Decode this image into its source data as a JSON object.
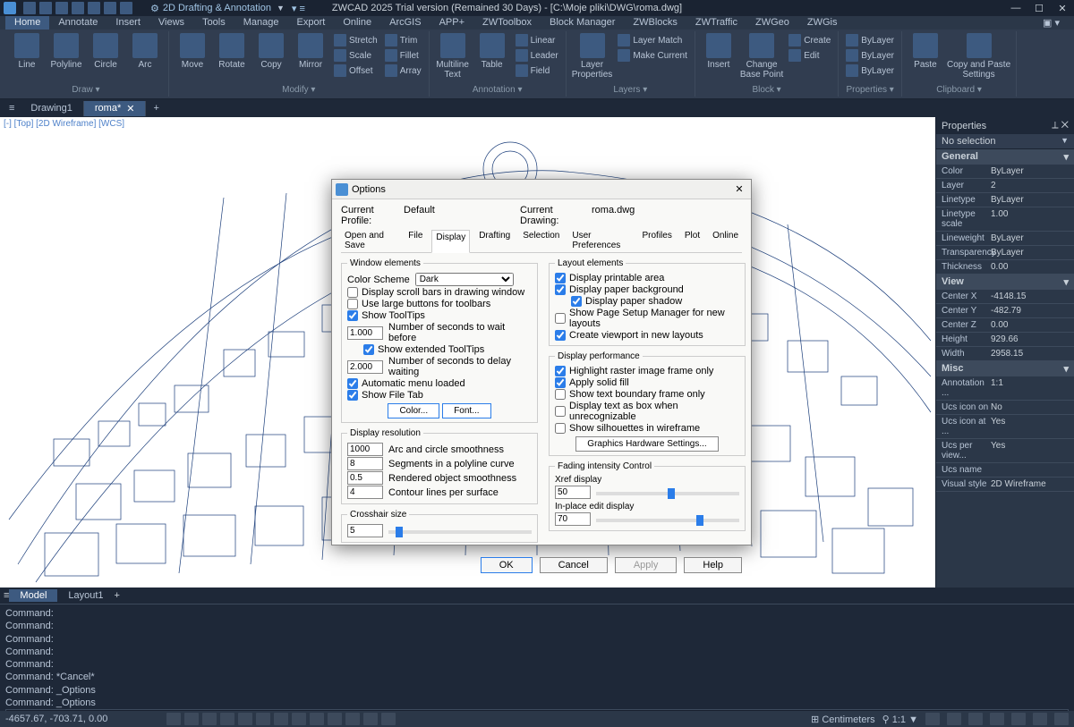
{
  "window": {
    "workspace": "2D Drafting & Annotation",
    "title": "ZWCAD 2025 Trial version (Remained 30 Days) - [C:\\Moje pliki\\DWG\\roma.dwg]"
  },
  "menubar": [
    "Home",
    "Annotate",
    "Insert",
    "Views",
    "Tools",
    "Manage",
    "Export",
    "Online",
    "ArcGIS",
    "APP+",
    "ZWToolbox",
    "Block Manager",
    "ZWBlocks",
    "ZWTraffic",
    "ZWGeo",
    "ZWGis"
  ],
  "menubar_active": "Home",
  "ribbon": {
    "panels": [
      {
        "label": "Draw",
        "big": [
          {
            "t": "Line"
          },
          {
            "t": "Polyline"
          },
          {
            "t": "Circle"
          },
          {
            "t": "Arc"
          }
        ]
      },
      {
        "label": "Modify",
        "big": [
          {
            "t": "Move"
          },
          {
            "t": "Rotate"
          },
          {
            "t": "Copy"
          },
          {
            "t": "Mirror"
          }
        ],
        "small": [
          [
            "Stretch",
            "Scale",
            "Offset"
          ],
          [
            "Trim",
            "Fillet",
            "Array"
          ]
        ]
      },
      {
        "label": "Annotation",
        "big": [
          {
            "t": "Multiline\nText"
          },
          {
            "t": "Table"
          }
        ],
        "small": [
          [
            "Linear",
            "Leader",
            "Field"
          ]
        ]
      },
      {
        "label": "Layers",
        "big": [
          {
            "t": "Layer\nProperties"
          }
        ],
        "small": [
          [
            "Layer Match",
            "Make Current"
          ]
        ]
      },
      {
        "label": "Block",
        "big": [
          {
            "t": "Insert"
          },
          {
            "t": "Change\nBase Point"
          }
        ],
        "small": [
          [
            "Create",
            "Edit"
          ]
        ]
      },
      {
        "label": "Properties",
        "small": [
          [
            "ByLayer",
            "ByLayer",
            "ByLayer"
          ]
        ]
      },
      {
        "label": "Clipboard",
        "big": [
          {
            "t": "Paste"
          },
          {
            "t": "Copy and Paste\nSettings"
          }
        ]
      }
    ]
  },
  "doc_tabs": [
    "Drawing1",
    "roma*"
  ],
  "doc_tabs_active": "roma*",
  "viewport_label": "[-] [Top] [2D Wireframe] [WCS]",
  "properties": {
    "title": "Properties",
    "selection": "No selection",
    "sections": [
      {
        "name": "General",
        "rows": [
          [
            "Color",
            "ByLayer"
          ],
          [
            "Layer",
            "2"
          ],
          [
            "Linetype",
            "ByLayer"
          ],
          [
            "Linetype scale",
            "1.00"
          ],
          [
            "Lineweight",
            "ByLayer"
          ],
          [
            "Transparency",
            "ByLayer"
          ],
          [
            "Thickness",
            "0.00"
          ]
        ]
      },
      {
        "name": "View",
        "rows": [
          [
            "Center X",
            "-4148.15"
          ],
          [
            "Center Y",
            "-482.79"
          ],
          [
            "Center Z",
            "0.00"
          ],
          [
            "Height",
            "929.66"
          ],
          [
            "Width",
            "2958.15"
          ]
        ]
      },
      {
        "name": "Misc",
        "rows": [
          [
            "Annotation ...",
            "1:1"
          ],
          [
            "Ucs icon on",
            "No"
          ],
          [
            "Ucs icon at ...",
            "Yes"
          ],
          [
            "Ucs per view...",
            "Yes"
          ],
          [
            "Ucs name",
            ""
          ],
          [
            "Visual style",
            "2D Wireframe"
          ]
        ]
      }
    ]
  },
  "bottom_tabs": [
    "Model",
    "Layout1"
  ],
  "bottom_tabs_active": "Model",
  "command_lines": [
    "Command:",
    "Command:",
    "Command:",
    "Command:",
    "Command:",
    "Command: *Cancel*",
    "Command: _Options",
    "Command: _Options"
  ],
  "status": {
    "coords": "-4657.67, -703.71, 0.00",
    "units": "Centimeters",
    "scale": "1:1"
  },
  "options": {
    "title": "Options",
    "current_profile_label": "Current Profile:",
    "current_profile": "Default",
    "current_drawing_label": "Current Drawing:",
    "current_drawing": "roma.dwg",
    "tabs": [
      "Open and Save",
      "File",
      "Display",
      "Drafting",
      "Selection",
      "User Preferences",
      "Profiles",
      "Plot",
      "Online"
    ],
    "tabs_active": "Display",
    "window_elements": {
      "legend": "Window elements",
      "color_scheme_label": "Color Scheme",
      "color_scheme": "Dark",
      "scroll_bars": "Display scroll bars in drawing window",
      "large_buttons": "Use large buttons for toolbars",
      "show_tooltips": "Show ToolTips",
      "seconds_wait": "1.000",
      "seconds_wait_label": "Number of seconds to wait before",
      "ext_tooltips": "Show extended ToolTips",
      "seconds_delay": "2.000",
      "seconds_delay_label": "Number of seconds to delay waiting",
      "auto_menu": "Automatic menu loaded",
      "file_tab": "Show File Tab",
      "color_btn": "Color...",
      "font_btn": "Font..."
    },
    "display_resolution": {
      "legend": "Display resolution",
      "arc": [
        "1000",
        "Arc and circle smoothness"
      ],
      "poly": [
        "8",
        "Segments in a polyline curve"
      ],
      "rend": [
        "0.5",
        "Rendered object smoothness"
      ],
      "contour": [
        "4",
        "Contour lines per surface"
      ]
    },
    "crosshair": {
      "legend": "Crosshair size",
      "value": "5"
    },
    "layout_elements": {
      "legend": "Layout elements",
      "printable": "Display printable area",
      "paper_bg": "Display paper background",
      "paper_shadow": "Display paper shadow",
      "page_setup": "Show Page Setup Manager for new layouts",
      "create_vp": "Create viewport in new layouts"
    },
    "display_perf": {
      "legend": "Display performance",
      "raster": "Highlight raster image frame only",
      "solid_fill": "Apply solid fill",
      "text_bound": "Show text boundary frame only",
      "text_box": "Display text as box when unrecognizable",
      "silh": "Show silhouettes in wireframe",
      "gfx_btn": "Graphics Hardware Settings..."
    },
    "fading": {
      "legend": "Fading intensity Control",
      "xref_label": "Xref display",
      "xref": "50",
      "inplace_label": "In-place edit display",
      "inplace": "70"
    },
    "buttons": {
      "ok": "OK",
      "cancel": "Cancel",
      "apply": "Apply",
      "help": "Help"
    }
  }
}
